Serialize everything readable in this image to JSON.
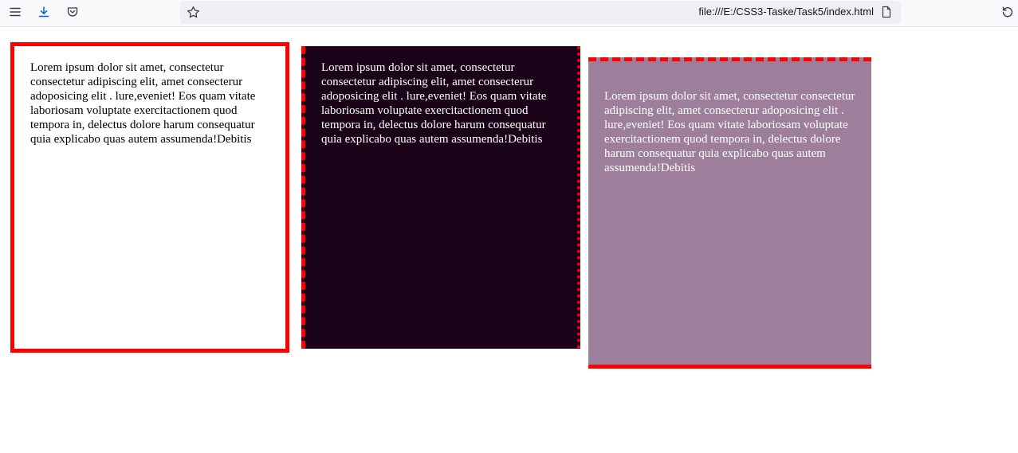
{
  "browser": {
    "url": "file:///E:/CSS3-Taske/Task5/index.html",
    "icons": {
      "menu": "menu-icon",
      "download": "download-icon",
      "pocket": "pocket-icon",
      "bookmark": "star-icon",
      "page": "page-icon",
      "reload": "reload-icon"
    }
  },
  "boxes": [
    {
      "text": "Lorem ipsum dolor sit amet, consectetur consectetur adipiscing elit, amet consecterur adoposicing elit . lure,eveniet! Eos quam vitate laboriosam voluptate exercitactionem quod tempora in, delectus dolore harum consequatur quia explicabo quas autem assumenda!Debitis",
      "background": "#ffffff",
      "border_color": "#ff0000"
    },
    {
      "text": "Lorem ipsum dolor sit amet, consectetur consectetur adipiscing elit, amet consecterur adoposicing elit . lure,eveniet! Eos quam vitate laboriosam voluptate exercitactionem quod tempora in, delectus dolore harum consequatur quia explicabo quas autem assumenda!Debitis",
      "background": "#1a0218",
      "border_color": "#ff0000"
    },
    {
      "text": "Lorem ipsum dolor sit amet, consectetur consectetur adipiscing elit, amet consecterur adoposicing elit . lure,eveniet! Eos quam vitate laboriosam voluptate exercitactionem quod tempora in, delectus dolore harum consequatur quia explicabo quas autem assumenda!Debitis",
      "background": "#9d7f9b",
      "border_color": "#ff0000"
    }
  ]
}
